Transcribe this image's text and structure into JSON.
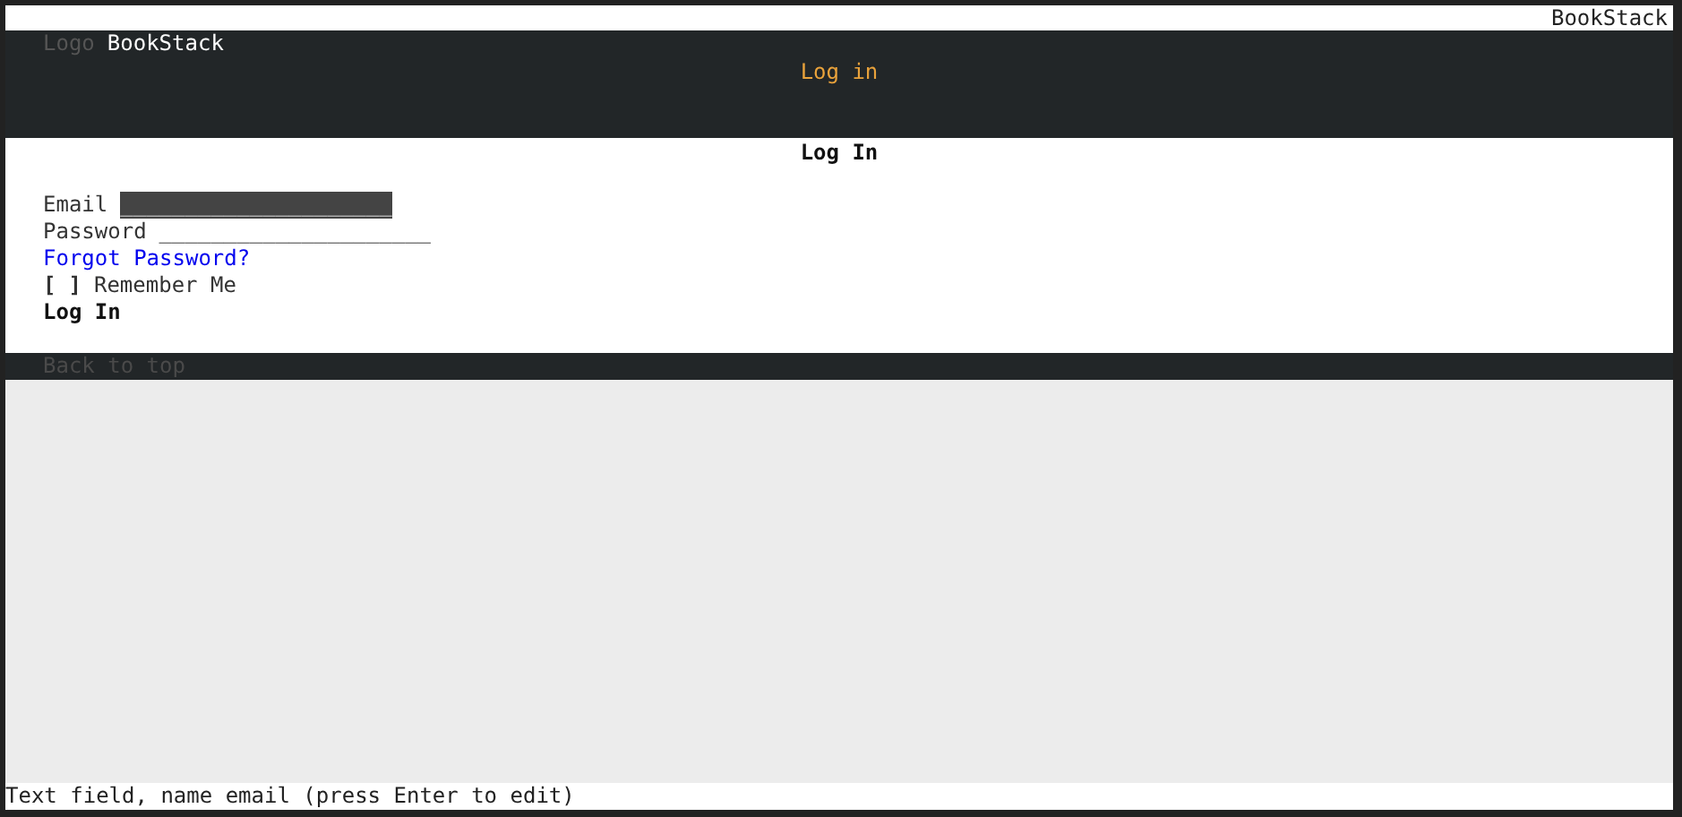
{
  "window": {
    "title": "BookStack"
  },
  "header": {
    "logo_alt": "Logo",
    "site_name": "BookStack",
    "nav_link": "Log in"
  },
  "form": {
    "heading": "Log In",
    "fields": [
      {
        "label": "Email",
        "value": "_____________________",
        "focused": true
      },
      {
        "label": "Password",
        "value": "_____________________",
        "focused": false
      }
    ],
    "forgot_link": "Forgot Password?",
    "remember": {
      "box_open": "[",
      "box_close": "]",
      "checked": false,
      "label": "Remember Me"
    },
    "submit": "Log In"
  },
  "footer": {
    "link": "Back to top"
  },
  "status_bar": "Text field, name email (press Enter to edit)"
}
